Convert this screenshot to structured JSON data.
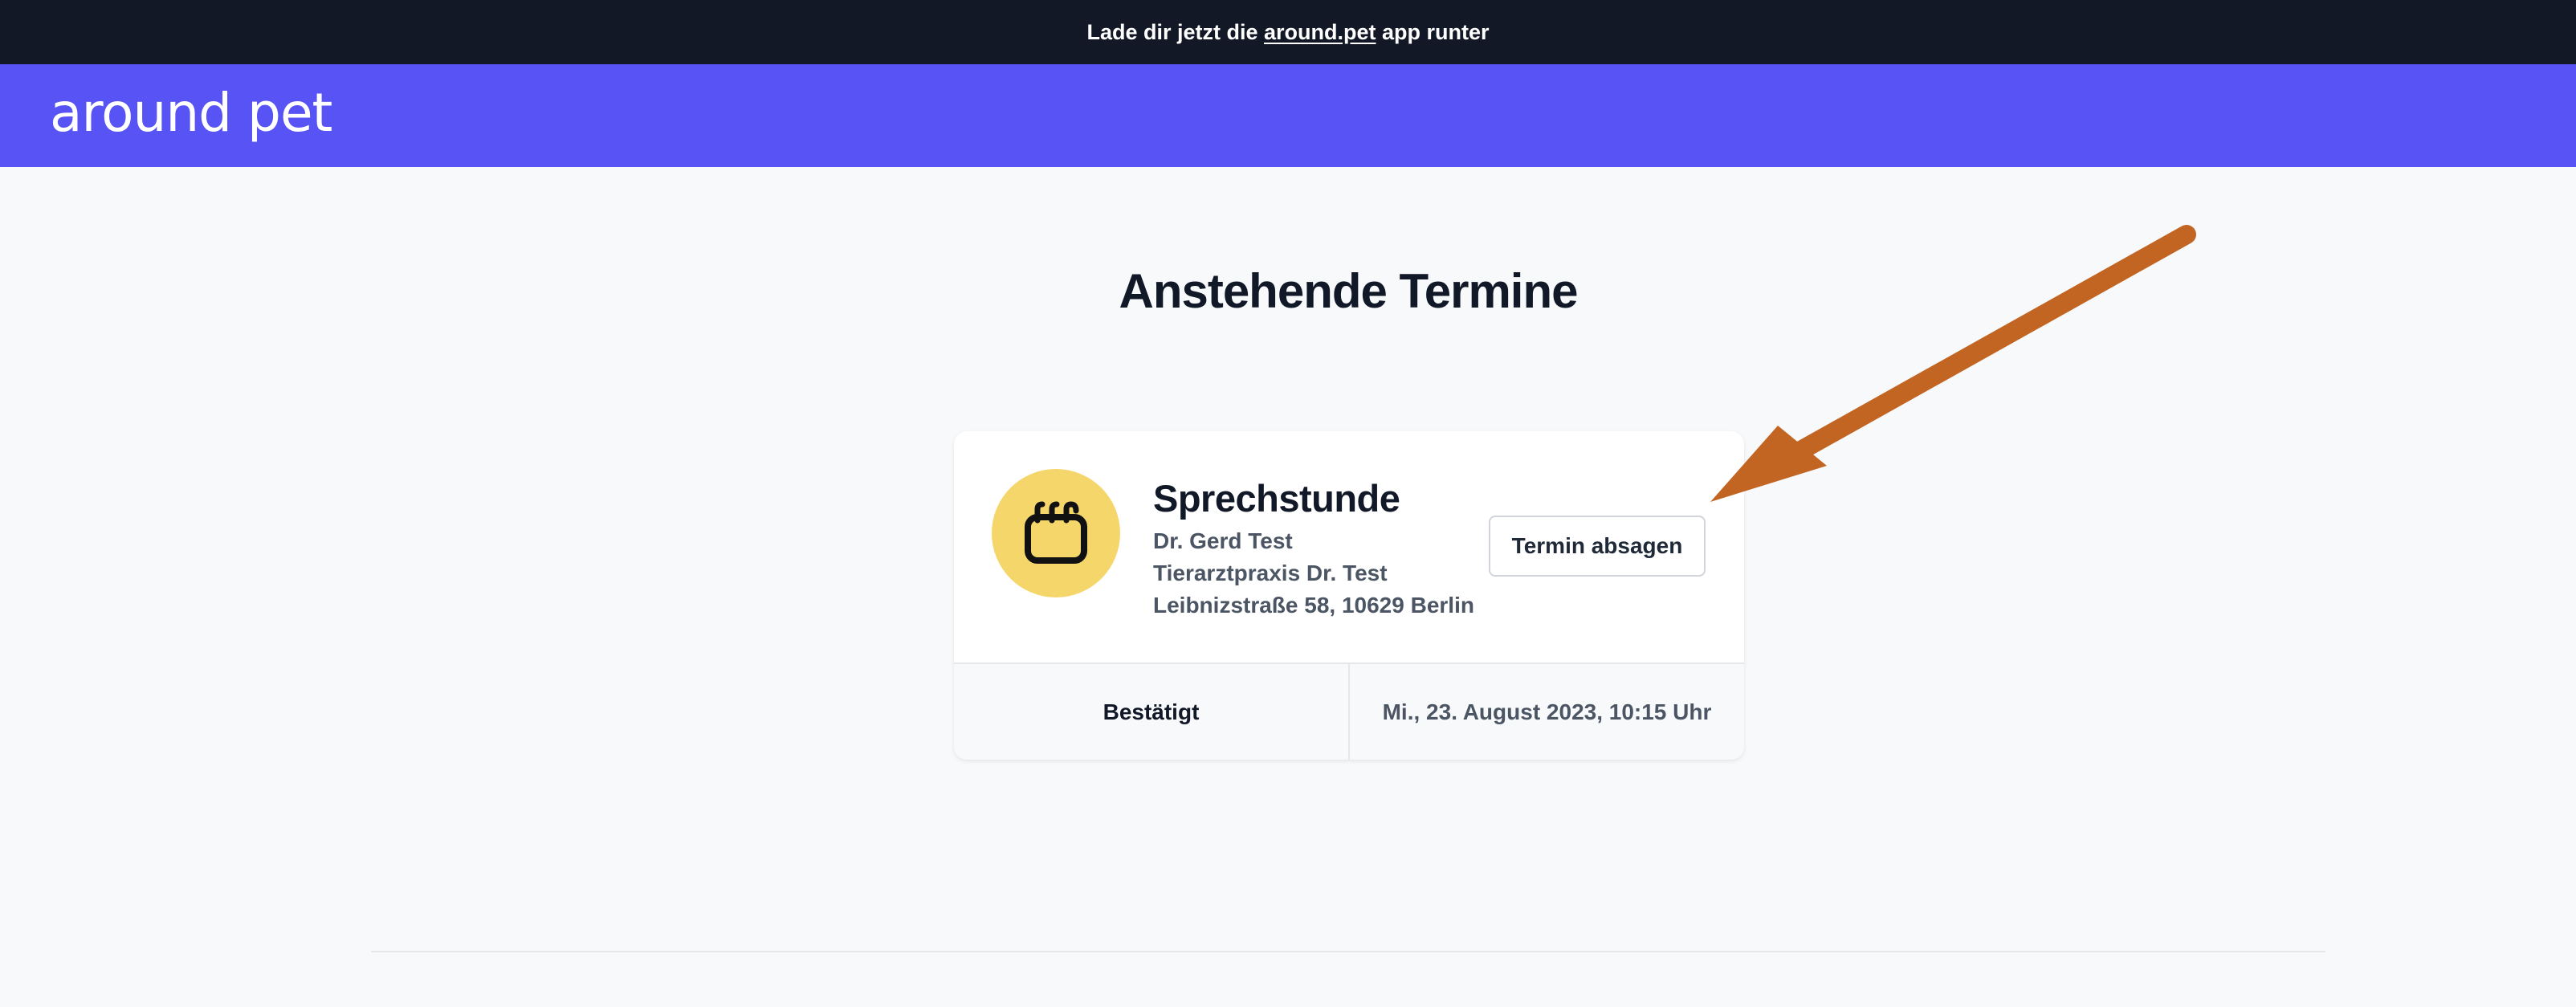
{
  "promo": {
    "text_before": "Lade dir jetzt die ",
    "link": "around.pet",
    "text_after": " app runter"
  },
  "header": {
    "logo": "around pet"
  },
  "main": {
    "title": "Anstehende Termine"
  },
  "appointment": {
    "icon": "calendar-icon",
    "type": "Sprechstunde",
    "doctor": "Dr. Gerd Test",
    "practice": "Tierarztpraxis Dr. Test",
    "address": "Leibnizstraße 58, 10629 Berlin",
    "cancel_label": "Termin absagen",
    "status": "Bestätigt",
    "datetime": "Mi., 23. August 2023, 10:15 Uhr"
  },
  "colors": {
    "promo_bg": "#121826",
    "brand": "#5753f5",
    "avatar_bg": "#f5d66b",
    "annotation_arrow": "#c26523"
  }
}
